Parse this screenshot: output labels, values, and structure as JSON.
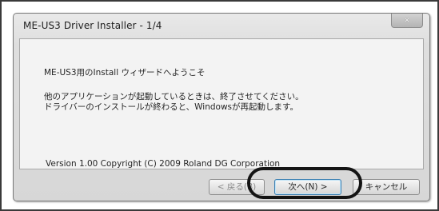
{
  "window": {
    "title": "ME-US3 Driver Installer - 1/4",
    "close_icon": "×"
  },
  "content": {
    "welcome": "ME-US3用のInstall ウィザードへようこそ",
    "message_line1": "他のアプリケーションが起動しているときは、終了させてください。",
    "message_line2": "ドライバーのインストールが終わると、Windowsが再起動します。",
    "version_text": "Version 1.00  Copyright (C) 2009 Roland DG Corporation"
  },
  "buttons": {
    "back": "< 戻る(B)",
    "next": "次へ(N) >",
    "cancel": "キャンセル"
  },
  "colors": {
    "highlight": "#141414"
  }
}
